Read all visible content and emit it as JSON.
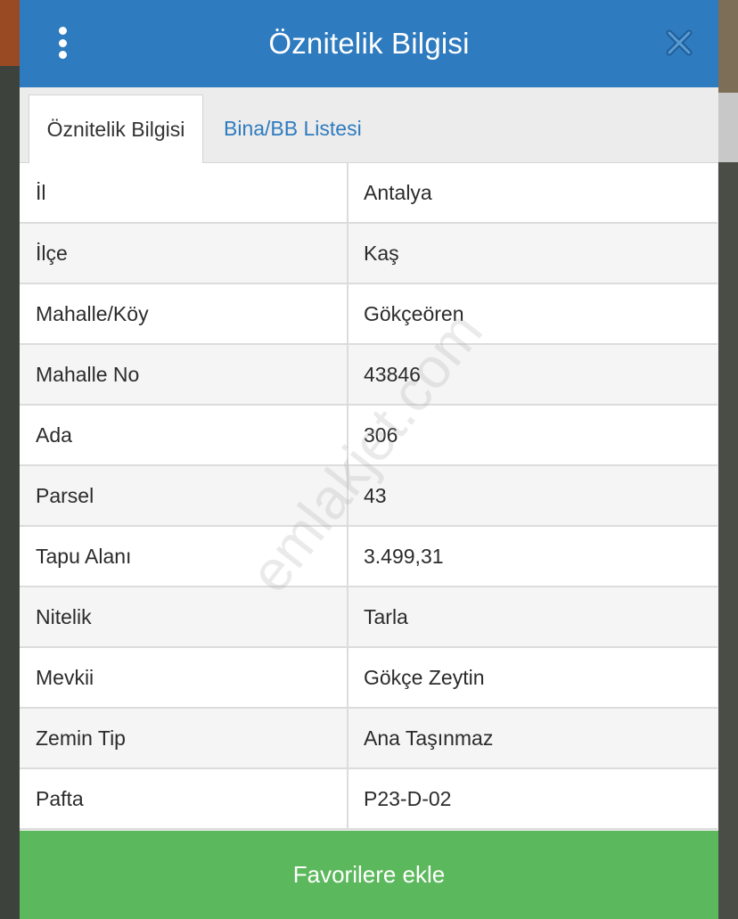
{
  "header": {
    "title": "Öznitelik Bilgisi",
    "menu_icon": "kebab-menu-icon",
    "close_icon": "close-icon",
    "color": "#2f7bbf"
  },
  "tabs": [
    {
      "label": "Öznitelik Bilgisi",
      "active": true
    },
    {
      "label": "Bina/BB Listesi",
      "active": false
    }
  ],
  "attributes": [
    {
      "key": "İl",
      "value": "Antalya"
    },
    {
      "key": "İlçe",
      "value": "Kaş"
    },
    {
      "key": "Mahalle/Köy",
      "value": "Gökçeören"
    },
    {
      "key": "Mahalle No",
      "value": "43846"
    },
    {
      "key": "Ada",
      "value": "306"
    },
    {
      "key": "Parsel",
      "value": "43"
    },
    {
      "key": "Tapu Alanı",
      "value": "3.499,31"
    },
    {
      "key": "Nitelik",
      "value": "Tarla"
    },
    {
      "key": "Mevkii",
      "value": "Gökçe Zeytin"
    },
    {
      "key": "Zemin Tip",
      "value": "Ana Taşınmaz"
    },
    {
      "key": "Pafta",
      "value": "P23-D-02"
    }
  ],
  "watermark": "emlakjet.com",
  "footer": {
    "favorite_label": "Favorilere ekle",
    "color": "#5cb85c"
  }
}
